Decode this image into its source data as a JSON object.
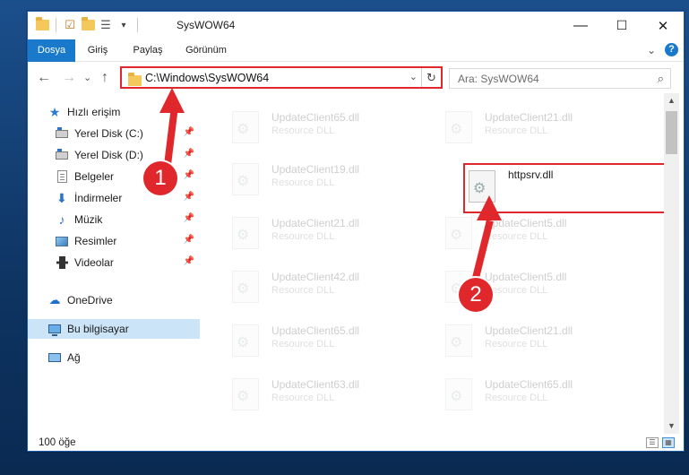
{
  "window": {
    "title": "SysWOW64",
    "minimize": "—",
    "maximize": "☐",
    "close": "✕"
  },
  "ribbon": {
    "tabs": [
      "Dosya",
      "Giriş",
      "Paylaş",
      "Görünüm"
    ],
    "active_tab": "Dosya",
    "expand": "⌄",
    "help": "?"
  },
  "navbar": {
    "back": "←",
    "forward": "→",
    "recent": "⌄",
    "up": "↑",
    "address": "C:\\Windows\\SysWOW64",
    "address_chevron": "⌄",
    "refresh": "↻",
    "search_placeholder": "Ara: SysWOW64",
    "search_icon": "⌕"
  },
  "sidebar": {
    "quick_access": "Hızlı erişim",
    "items": [
      {
        "label": "Yerel Disk (C:)",
        "icon": "drive-icon",
        "pinned": true
      },
      {
        "label": "Yerel Disk (D:)",
        "icon": "drive-icon",
        "pinned": true
      },
      {
        "label": "Belgeler",
        "icon": "documents-icon",
        "pinned": true
      },
      {
        "label": "İndirmeler",
        "icon": "downloads-icon",
        "pinned": true
      },
      {
        "label": "Müzik",
        "icon": "music-icon",
        "pinned": true
      },
      {
        "label": "Resimler",
        "icon": "pictures-icon",
        "pinned": true
      },
      {
        "label": "Videolar",
        "icon": "videos-icon",
        "pinned": true
      }
    ],
    "onedrive": "OneDrive",
    "this_pc": "Bu bilgisayar",
    "network": "Ağ",
    "pin_glyph": "📌"
  },
  "files": {
    "left_column": [
      {
        "name": "UpdateClient65.dll",
        "type": "Resource DLL"
      },
      {
        "name": "UpdateClient19.dll",
        "type": "Resource DLL"
      },
      {
        "name": "UpdateClient21.dll",
        "type": "Resource DLL"
      },
      {
        "name": "UpdateClient42.dll",
        "type": "Resource DLL"
      },
      {
        "name": "UpdateClient65.dll",
        "type": "Resource DLL"
      },
      {
        "name": "UpdateClient63.dll",
        "type": "Resource DLL"
      }
    ],
    "right_column": [
      {
        "name": "UpdateClient21.dll",
        "type": "Resource DLL"
      },
      {
        "name": "httpsrv.dll",
        "type": ""
      },
      {
        "name": "UpdateClient5.dll",
        "type": "Resource DLL"
      },
      {
        "name": "UpdateClient5.dll",
        "type": "Resource DLL"
      },
      {
        "name": "UpdateClient21.dll",
        "type": "Resource DLL"
      },
      {
        "name": "UpdateClient65.dll",
        "type": "Resource DLL"
      }
    ],
    "highlighted": "httpsrv.dll"
  },
  "status": {
    "count": "100 öğe"
  },
  "callouts": [
    "1",
    "2"
  ],
  "colors": {
    "accent": "#1979ca",
    "highlight": "#e0282c",
    "selection": "#cce4f7"
  }
}
